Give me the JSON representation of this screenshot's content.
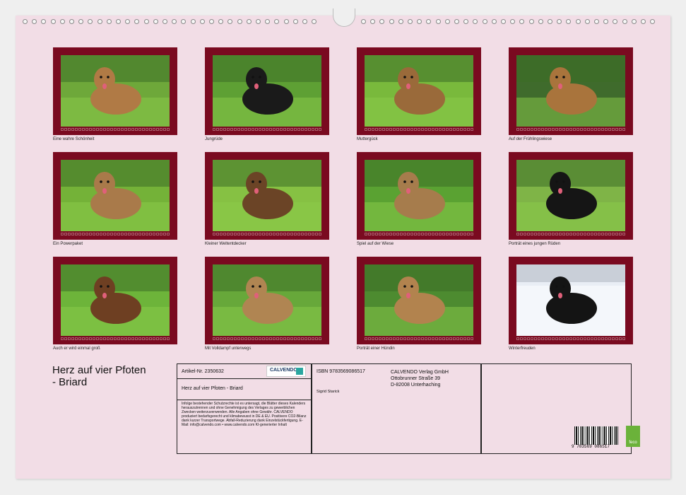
{
  "calendar": {
    "title_line1": "Herz auf vier Pfoten",
    "title_line2": "- Briard",
    "colors": {
      "frame": "#7a0a20",
      "page_bg": "#f2dde6"
    }
  },
  "photos": [
    {
      "caption": "Eine wahre Schönheit",
      "bg": "#6ea83a",
      "dog": "#b07a45"
    },
    {
      "caption": "Jungrüde",
      "bg": "#5ea034",
      "dog": "#1a1a1a"
    },
    {
      "caption": "Muttergück",
      "bg": "#79b93c",
      "dog": "#9a6a3a"
    },
    {
      "caption": "Auf der Frühlingswiese",
      "bg": "#3f6b2c",
      "dog": "#a9743c"
    },
    {
      "caption": "Ein Powerpaket",
      "bg": "#74b238",
      "dog": "#a97a4a"
    },
    {
      "caption": "Kleiner Weltentdecker",
      "bg": "#86c143",
      "dog": "#6b4426"
    },
    {
      "caption": "Spiel auf der Wiese",
      "bg": "#5aa232",
      "dog": "#a67c4c"
    },
    {
      "caption": "Porträt eines jungen Rüden",
      "bg": "#7fb447",
      "dog": "#151515"
    },
    {
      "caption": "Auch er wird einmal groß",
      "bg": "#6db43a",
      "dog": "#6e3f22"
    },
    {
      "caption": "Mit Volldampf unterwegs",
      "bg": "#67a83a",
      "dog": "#b08552"
    },
    {
      "caption": "Porträt einer Hündin",
      "bg": "#4d8b30",
      "dog": "#b2834e"
    },
    {
      "caption": "Winterfreuden",
      "bg": "#e9eef5",
      "dog": "#141414"
    }
  ],
  "info": {
    "article": "Artikel-Nr. 2350632",
    "logo_text": "CALVENDO",
    "isbn": "ISBN 9783569086517",
    "publisher": [
      "CALVENDO Verlag GmbH",
      "Ottobrunner Straße 39",
      "D-82008 Unterhaching"
    ],
    "subtitle": "Herz auf vier Pfoten - Briard",
    "author": "Sigrid Starick",
    "legal": "Infolge bestehender Schutzrechte ist es untersagt, die Blätter dieses Kalenders herauszutrennen und ohne Genehmigung des Verlages zu gewerblichen Zwecken weiterzuverwenden. Alle Angaben ohne Gewähr. CALVENDO produziert bedarfsgerecht und klimabewusst in DE & EU. Positivere CO2-Bilanz dank kurzer Transportwege. Abfall-Reduzierung dank Einzelstückfertigung. E-Mail: info@calvendo.com • www.calvendo.com KI-generierter Inhalt",
    "barcode_digits": "9 783569 086517",
    "eco_label": "feco"
  }
}
